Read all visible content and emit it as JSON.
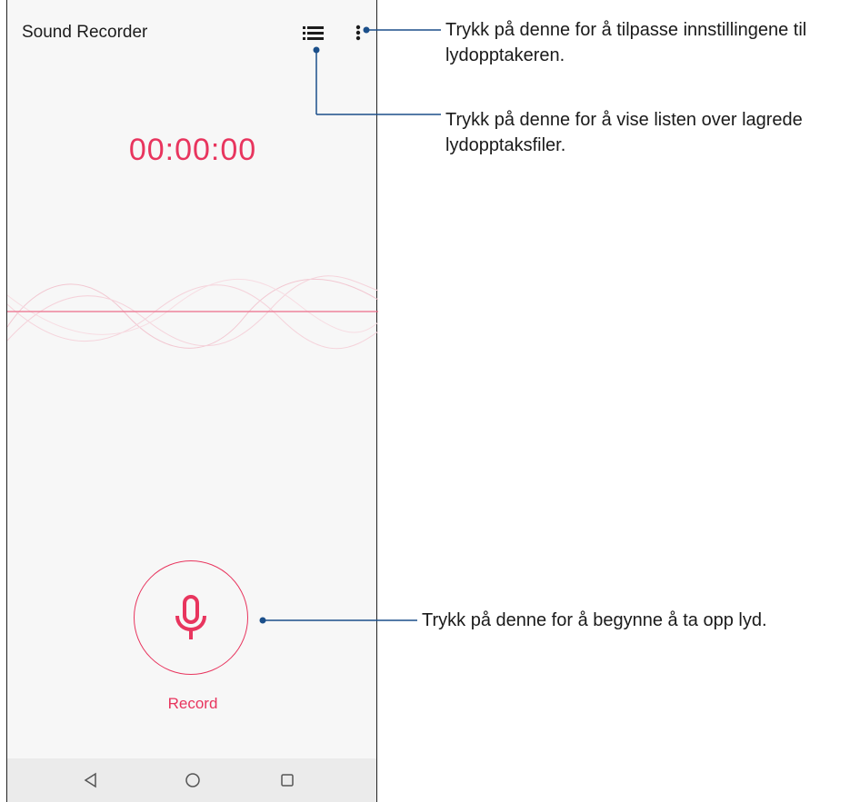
{
  "app": {
    "title": "Sound Recorder",
    "timer": "00:00:00",
    "record_label": "Record"
  },
  "icons": {
    "list": "list-icon",
    "more": "more-vert-icon",
    "mic": "microphone-icon",
    "back": "back-triangle-icon",
    "home": "home-circle-icon",
    "recents": "recents-square-icon"
  },
  "callouts": {
    "settings_line1": "Trykk på denne for å tilpasse innstillingene til",
    "settings_line2": "lydopptakeren.",
    "list_line1": "Trykk på denne for å vise listen over lagrede",
    "list_line2": "lydopptaksfiler.",
    "record": "Trykk på denne for å begynne å ta opp lyd."
  },
  "colors": {
    "accent": "#e8355e",
    "callout_line": "#1b4f8a",
    "background": "#f7f7f7",
    "navbar": "#ebebeb"
  }
}
